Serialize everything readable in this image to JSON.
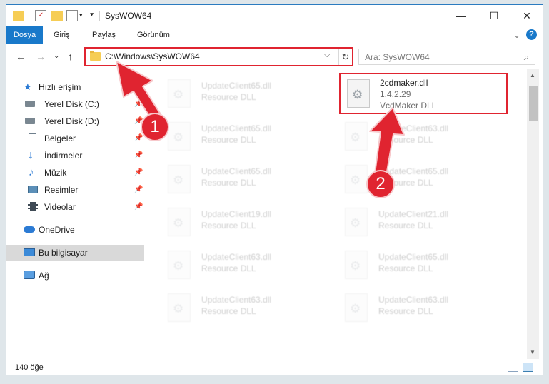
{
  "window": {
    "title": "SysWOW64",
    "controls": {
      "minimize": "—",
      "maximize": "☐",
      "close": "✕"
    }
  },
  "ribbon": {
    "tabs": [
      "Dosya",
      "Giriş",
      "Paylaş",
      "Görünüm"
    ],
    "expand_icon": "⌄",
    "help_icon": "?"
  },
  "address": {
    "path": "C:\\Windows\\SysWOW64",
    "dropdown_icon": "⌵",
    "refresh_icon": "↻",
    "back_icon": "←",
    "forward_icon": "→",
    "history_icon": "⌄",
    "up_icon": "↑"
  },
  "search": {
    "placeholder": "Ara: SysWOW64",
    "icon": "⌕"
  },
  "nav": {
    "quick_access": "Hızlı erişim",
    "items": [
      {
        "label": "Yerel Disk (C:)",
        "icon": "drive-icon",
        "pin": "📌"
      },
      {
        "label": "Yerel Disk (D:)",
        "icon": "drive-icon",
        "pin": "📌"
      },
      {
        "label": "Belgeler",
        "icon": "documents-icon",
        "pin": "📌"
      },
      {
        "label": "İndirmeler",
        "icon": "download-icon",
        "pin": "📌"
      },
      {
        "label": "Müzik",
        "icon": "music-icon",
        "pin": "📌"
      },
      {
        "label": "Resimler",
        "icon": "pictures-icon",
        "pin": "📌"
      },
      {
        "label": "Videolar",
        "icon": "videos-icon",
        "pin": "📌"
      }
    ],
    "onedrive": "OneDrive",
    "this_pc": "Bu bilgisayar",
    "network": "Ağ"
  },
  "files": {
    "highlighted": {
      "name": "2cdmaker.dll",
      "version": "1.4.2.29",
      "description": "VcdMaker DLL"
    },
    "faded": [
      {
        "name": "UpdateClient65.dll",
        "type": "Resource DLL"
      },
      {
        "name": "UpdateClient65.dll",
        "type": "Resource DLL"
      },
      {
        "name": "UpdateClient63.dll",
        "type": "Resource DLL"
      },
      {
        "name": "UpdateClient65.dll",
        "type": "Resource DLL"
      },
      {
        "name": "UpdateClient65.dll",
        "type": "Resource DLL"
      },
      {
        "name": "UpdateClient19.dll",
        "type": "Resource DLL"
      },
      {
        "name": "UpdateClient21.dll",
        "type": "Resource DLL"
      },
      {
        "name": "UpdateClient63.dll",
        "type": "Resource DLL"
      },
      {
        "name": "UpdateClient65.dll",
        "type": "Resource DLL"
      },
      {
        "name": "UpdateClient63.dll",
        "type": "Resource DLL"
      },
      {
        "name": "UpdateClient63.dll",
        "type": "Resource DLL"
      }
    ]
  },
  "status": {
    "item_count": "140 öğe"
  },
  "annotations": {
    "step1": "1",
    "step2": "2",
    "color": "#e02430"
  }
}
